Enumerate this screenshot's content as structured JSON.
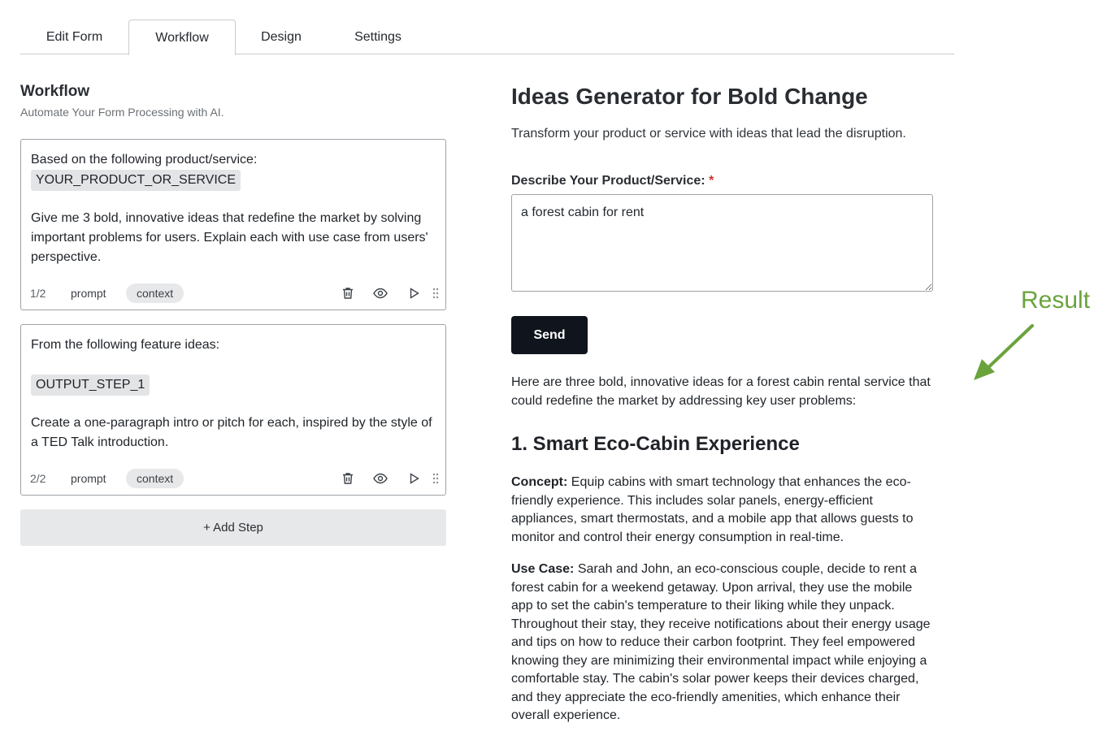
{
  "tabs": [
    {
      "label": "Edit Form"
    },
    {
      "label": "Workflow"
    },
    {
      "label": "Design"
    },
    {
      "label": "Settings"
    }
  ],
  "workflow": {
    "title": "Workflow",
    "subtitle": "Automate Your Form Processing with AI.",
    "steps": [
      {
        "line1": "Based on the following product/service:",
        "variable": "YOUR_PRODUCT_OR_SERVICE",
        "instruction": "Give me 3 bold, innovative ideas that redefine the market by solving important problems for users. Explain each with use case from users' perspective.",
        "count": "1/2",
        "prompt_label": "prompt",
        "context_label": "context"
      },
      {
        "line1": "From the following feature ideas:",
        "variable": "OUTPUT_STEP_1",
        "instruction": "Create a one-paragraph intro or pitch for each, inspired by the style of a TED Talk introduction.",
        "count": "2/2",
        "prompt_label": "prompt",
        "context_label": "context"
      }
    ],
    "add_step_label": "+ Add Step"
  },
  "form": {
    "title": "Ideas Generator for Bold Change",
    "description": "Transform your product or service with ideas that lead the disruption.",
    "field_label": "Describe Your Product/Service:",
    "required_mark": "*",
    "field_value": "a forest cabin for rent",
    "send_label": "Send"
  },
  "result": {
    "intro": "Here are three bold, innovative ideas for a forest cabin rental service that could redefine the market by addressing key user problems:",
    "heading": "1. Smart Eco-Cabin Experience",
    "concept_label": "Concept:",
    "concept_text": " Equip cabins with smart technology that enhances the eco-friendly experience. This includes solar panels, energy-efficient appliances, smart thermostats, and a mobile app that allows guests to monitor and control their energy consumption in real-time.",
    "usecase_label": "Use Case:",
    "usecase_text": " Sarah and John, an eco-conscious couple, decide to rent a forest cabin for a weekend getaway. Upon arrival, they use the mobile app to set the cabin's temperature to their liking while they unpack. Throughout their stay, they receive notifications about their energy usage and tips on how to reduce their carbon footprint. They feel empowered knowing they are minimizing their environmental impact while enjoying a comfortable stay. The cabin's solar power keeps their devices charged, and they appreciate the eco-friendly amenities, which enhance their overall experience."
  },
  "annotation": {
    "label": "Result",
    "color": "#6aa33c"
  },
  "icons": [
    "trash-icon",
    "eye-icon",
    "play-icon",
    "drag-handle-icon"
  ]
}
